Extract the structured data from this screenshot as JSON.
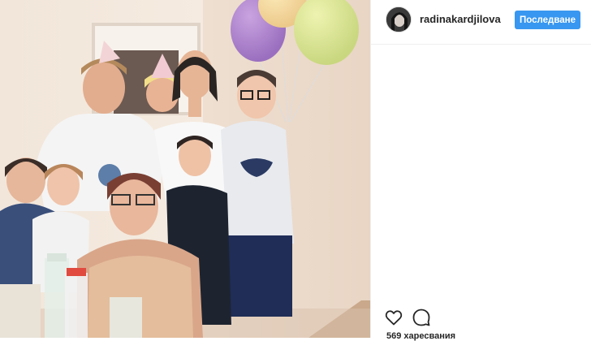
{
  "post": {
    "username": "radinakardjilova",
    "follow_label": "Последване",
    "likes_text": "569 харесвания"
  },
  "icons": {
    "like": "heart-outline-icon",
    "comment": "comment-bubble-icon"
  },
  "colors": {
    "follow_button": "#3897f0",
    "text": "#262626",
    "divider": "#efefef"
  }
}
